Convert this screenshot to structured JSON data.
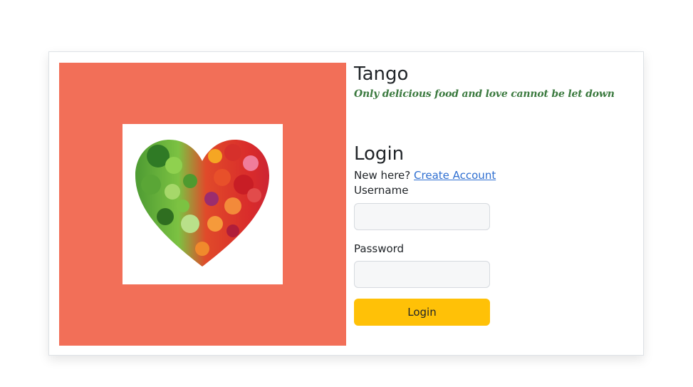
{
  "brand": {
    "name": "Tango",
    "tagline": "Only delicious food and love cannot be let down"
  },
  "hero": {
    "background_color": "#f26f58",
    "image_icon": "vegetable-heart-icon"
  },
  "login": {
    "title": "Login",
    "new_here_text": "New here?",
    "create_account_link": "Create Account",
    "username_label": "Username",
    "username_value": "",
    "password_label": "Password",
    "password_value": "",
    "submit_label": "Login",
    "submit_color": "#ffc107"
  }
}
